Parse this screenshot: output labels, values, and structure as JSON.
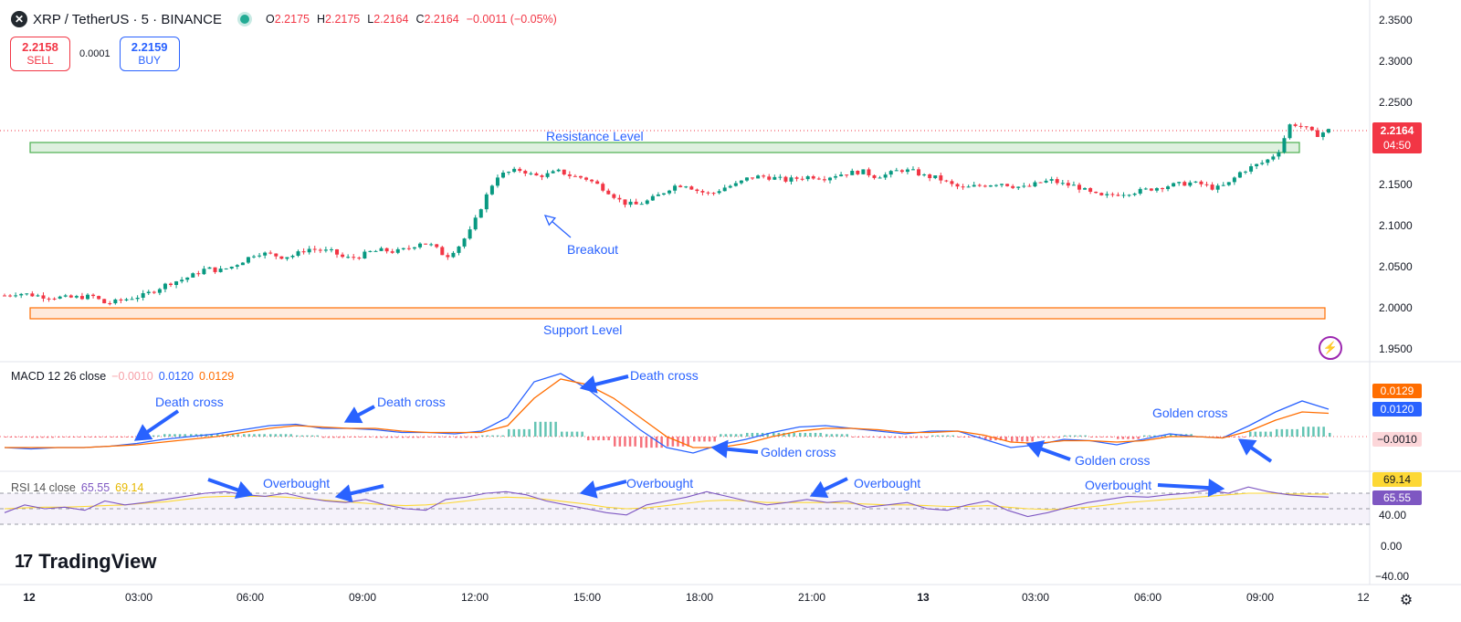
{
  "header": {
    "symbol": "XRP / TetherUS · 5 · BINANCE",
    "o_label": "O",
    "o_value": "2.2175",
    "h_label": "H",
    "h_value": "2.2175",
    "l_label": "L",
    "l_value": "2.2164",
    "c_label": "C",
    "c_value": "2.2164",
    "change": "−0.0011 (−0.05%)"
  },
  "trade": {
    "sell_price": "2.2158",
    "sell_label": "SELL",
    "spread": "0.0001",
    "buy_price": "2.2159",
    "buy_label": "BUY"
  },
  "macd_legend": {
    "name": "MACD 12 26 close",
    "hist": "−0.0010",
    "macd": "0.0120",
    "signal": "0.0129"
  },
  "rsi_legend": {
    "name": "RSI 14 close",
    "rsi": "65.55",
    "ma": "69.14"
  },
  "branding": {
    "logo_text": "TradingView"
  },
  "colors": {
    "up": "#089981",
    "down": "#f23645",
    "macd": "#2962ff",
    "signal": "#ff6d00",
    "rsi": "#7e57c2",
    "rsi_ma": "#fdd835",
    "annotation": "#2962ff"
  },
  "chart_data": [
    {
      "type": "candlestick",
      "title": "XRP / TetherUS · 5 · BINANCE",
      "price_axis_ticks": [
        "2.3500",
        "2.3000",
        "2.2500",
        "2.2000",
        "2.1500",
        "2.1000",
        "2.0500",
        "2.0000",
        "1.9500"
      ],
      "ylim": [
        1.93,
        2.36
      ],
      "time_ticks": [
        "12",
        "03:00",
        "06:00",
        "09:00",
        "12:00",
        "15:00",
        "18:00",
        "21:00",
        "13",
        "03:00",
        "06:00",
        "09:00",
        "12"
      ],
      "last_price": "2.2164",
      "countdown": "04:50",
      "close_path": [
        [
          0,
          2.015
        ],
        [
          1,
          2.018
        ],
        [
          2,
          2.016
        ],
        [
          3,
          2.014
        ],
        [
          4,
          2.013
        ],
        [
          5,
          2.012
        ],
        [
          6,
          2.013
        ],
        [
          7,
          2.014
        ],
        [
          8,
          2.005
        ],
        [
          9,
          2.008
        ],
        [
          10,
          2.012
        ],
        [
          11,
          2.015
        ],
        [
          12,
          2.022
        ],
        [
          13,
          2.03
        ],
        [
          14,
          2.034
        ],
        [
          15,
          2.04
        ],
        [
          16,
          2.048
        ],
        [
          17,
          2.045
        ],
        [
          18,
          2.05
        ],
        [
          19,
          2.058
        ],
        [
          20,
          2.067
        ],
        [
          21,
          2.065
        ],
        [
          22,
          2.062
        ],
        [
          23,
          2.064
        ],
        [
          24,
          2.072
        ],
        [
          25,
          2.07
        ],
        [
          26,
          2.068
        ],
        [
          27,
          2.06
        ],
        [
          28,
          2.062
        ],
        [
          29,
          2.068
        ],
        [
          30,
          2.07
        ],
        [
          31,
          2.068
        ],
        [
          32,
          2.072
        ],
        [
          33,
          2.08
        ],
        [
          34,
          2.075
        ],
        [
          35,
          2.062
        ],
        [
          36,
          2.075
        ],
        [
          37,
          2.095
        ],
        [
          38,
          2.13
        ],
        [
          39,
          2.16
        ],
        [
          40,
          2.165
        ],
        [
          41,
          2.168
        ],
        [
          42,
          2.16
        ],
        [
          43,
          2.162
        ],
        [
          44,
          2.166
        ],
        [
          45,
          2.16
        ],
        [
          46,
          2.158
        ],
        [
          47,
          2.15
        ],
        [
          48,
          2.14
        ],
        [
          49,
          2.128
        ],
        [
          50,
          2.125
        ],
        [
          51,
          2.13
        ],
        [
          52,
          2.138
        ],
        [
          53,
          2.148
        ],
        [
          54,
          2.15
        ],
        [
          55,
          2.142
        ],
        [
          56,
          2.138
        ],
        [
          57,
          2.146
        ],
        [
          58,
          2.15
        ],
        [
          59,
          2.158
        ],
        [
          60,
          2.16
        ],
        [
          61,
          2.158
        ],
        [
          62,
          2.155
        ],
        [
          63,
          2.158
        ],
        [
          64,
          2.16
        ],
        [
          65,
          2.158
        ],
        [
          66,
          2.162
        ],
        [
          67,
          2.164
        ],
        [
          68,
          2.166
        ],
        [
          69,
          2.16
        ],
        [
          70,
          2.162
        ],
        [
          71,
          2.168
        ],
        [
          72,
          2.166
        ],
        [
          73,
          2.16
        ],
        [
          74,
          2.158
        ],
        [
          75,
          2.15
        ],
        [
          76,
          2.145
        ],
        [
          77,
          2.148
        ],
        [
          78,
          2.15
        ],
        [
          79,
          2.152
        ],
        [
          80,
          2.148
        ],
        [
          81,
          2.146
        ],
        [
          82,
          2.152
        ],
        [
          83,
          2.155
        ],
        [
          84,
          2.15
        ],
        [
          85,
          2.148
        ],
        [
          86,
          2.14
        ],
        [
          87,
          2.135
        ],
        [
          88,
          2.138
        ],
        [
          89,
          2.14
        ],
        [
          90,
          2.142
        ],
        [
          91,
          2.145
        ],
        [
          92,
          2.148
        ],
        [
          93,
          2.15
        ],
        [
          94,
          2.152
        ],
        [
          95,
          2.15
        ],
        [
          96,
          2.145
        ],
        [
          97,
          2.15
        ],
        [
          98,
          2.165
        ],
        [
          99,
          2.172
        ],
        [
          100,
          2.178
        ],
        [
          101,
          2.19
        ],
        [
          102,
          2.225
        ],
        [
          103,
          2.22
        ],
        [
          104,
          2.21
        ],
        [
          105,
          2.216
        ]
      ]
    },
    {
      "type": "line",
      "title": "MACD 12 26 close",
      "series": [
        {
          "name": "MACD",
          "values": [
            -0.008,
            -0.009,
            -0.008,
            -0.008,
            -0.007,
            -0.005,
            -0.002,
            0.0,
            0.002,
            0.005,
            0.008,
            0.009,
            0.006,
            0.006,
            0.005,
            0.003,
            0.003,
            0.002,
            0.004,
            0.014,
            0.04,
            0.046,
            0.035,
            0.02,
            0.005,
            -0.008,
            -0.012,
            -0.006,
            -0.002,
            0.003,
            0.007,
            0.008,
            0.006,
            0.004,
            0.002,
            0.004,
            0.004,
            -0.002,
            -0.008,
            -0.006,
            -0.002,
            -0.003,
            -0.006,
            -0.002,
            0.002,
            0.0,
            -0.001,
            0.008,
            0.018,
            0.026,
            0.02
          ]
        },
        {
          "name": "Signal",
          "values": [
            -0.008,
            -0.008,
            -0.008,
            -0.008,
            -0.007,
            -0.006,
            -0.004,
            -0.002,
            0.0,
            0.003,
            0.006,
            0.008,
            0.007,
            0.006,
            0.006,
            0.004,
            0.003,
            0.003,
            0.003,
            0.008,
            0.028,
            0.042,
            0.038,
            0.028,
            0.014,
            0.0,
            -0.008,
            -0.008,
            -0.005,
            0.0,
            0.004,
            0.006,
            0.006,
            0.005,
            0.003,
            0.003,
            0.004,
            0.001,
            -0.004,
            -0.005,
            -0.003,
            -0.003,
            -0.004,
            -0.003,
            0.0,
            0.0,
            -0.001,
            0.004,
            0.012,
            0.018,
            0.017
          ]
        }
      ],
      "value_labels": [
        "0.0129",
        "0.0120",
        "−0.0010"
      ]
    },
    {
      "type": "line",
      "title": "RSI 14 close",
      "series": [
        {
          "name": "RSI",
          "values": [
            45,
            55,
            50,
            52,
            48,
            60,
            55,
            58,
            62,
            66,
            70,
            72,
            68,
            66,
            70,
            64,
            60,
            58,
            62,
            55,
            50,
            48,
            62,
            65,
            70,
            72,
            68,
            60,
            55,
            50,
            45,
            42,
            55,
            60,
            65,
            72,
            66,
            60,
            55,
            58,
            62,
            58,
            60,
            52,
            55,
            58,
            50,
            48,
            55,
            60,
            48,
            40,
            45,
            52,
            58,
            62,
            66,
            65,
            68,
            70,
            74,
            70,
            78,
            72,
            68,
            66,
            65
          ]
        },
        {
          "name": "RSI-based MA",
          "values": [
            50,
            51,
            52,
            52,
            53,
            54,
            55,
            57,
            59,
            62,
            65,
            66,
            66,
            66,
            65,
            63,
            61,
            59,
            57,
            55,
            54,
            55,
            57,
            60,
            63,
            65,
            64,
            62,
            59,
            56,
            52,
            50,
            51,
            54,
            57,
            60,
            61,
            60,
            58,
            58,
            58,
            58,
            57,
            56,
            55,
            55,
            54,
            53,
            53,
            54,
            52,
            50,
            49,
            50,
            52,
            55,
            58,
            60,
            62,
            64,
            66,
            68,
            70,
            70,
            69,
            69,
            69
          ]
        }
      ],
      "axis_ticks": [
        "69.14",
        "65.55",
        "40.00",
        "0.00",
        "−40.00"
      ],
      "levels": [
        70,
        30
      ]
    }
  ],
  "annotations": {
    "resistance": "Resistance Level",
    "support": "Support Level",
    "breakout": "Breakout",
    "macd_death_1": "Death cross",
    "macd_death_2": "Death cross",
    "macd_death_3": "Death cross",
    "macd_golden_1": "Golden cross",
    "macd_golden_2": "Golden cross",
    "macd_golden_3": "Golden cross",
    "rsi_ob_1": "Overbought",
    "rsi_ob_2": "Overbought",
    "rsi_ob_3": "Overbought",
    "rsi_ob_4": "Overbought"
  }
}
